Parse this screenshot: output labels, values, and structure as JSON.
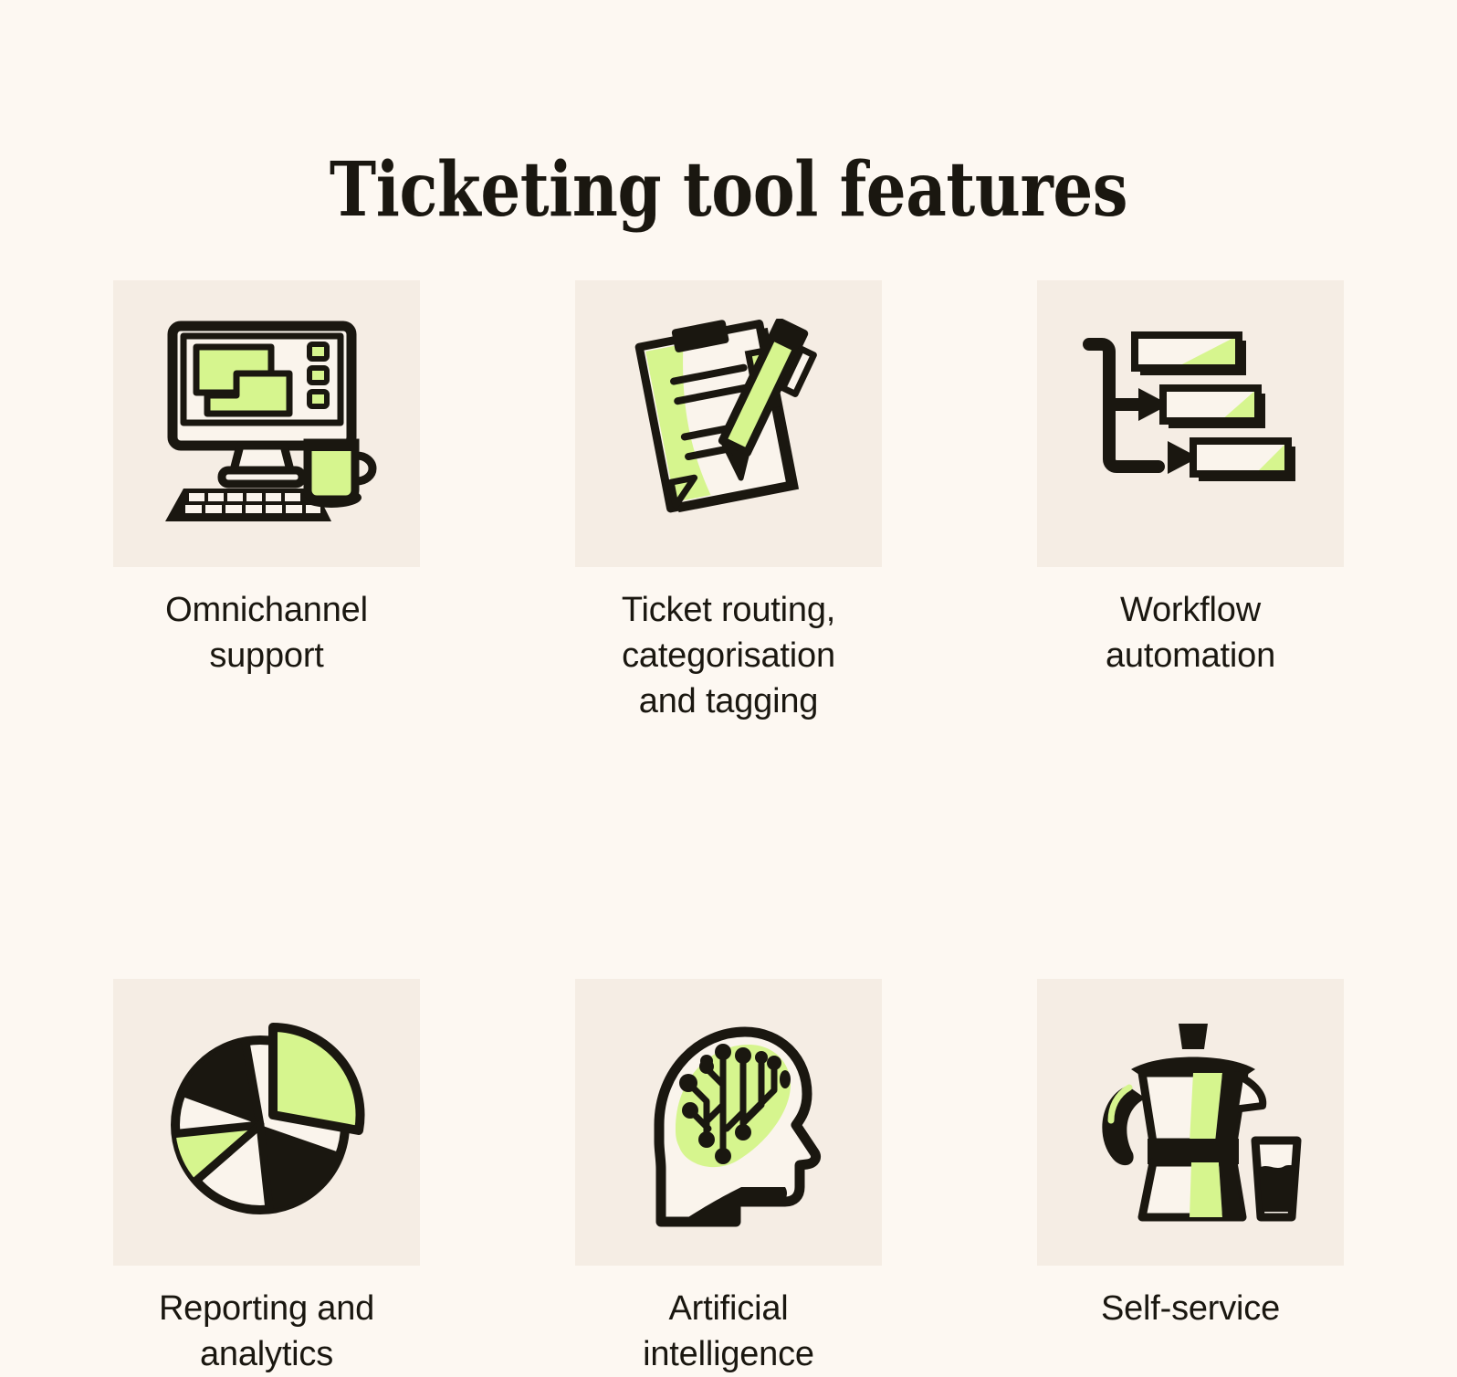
{
  "page": {
    "title": "Ticketing tool features",
    "background_color": "#FDF8F2",
    "tile_color": "#F5EDE4",
    "ink_color": "#1A1710",
    "accent_color": "#D6F58E"
  },
  "features": [
    {
      "id": "omnichannel-support",
      "caption": "Omnichannel\nsupport",
      "icon": "desktop-computer-icon"
    },
    {
      "id": "ticket-routing",
      "caption": "Ticket routing,\ncategorisation\nand tagging",
      "icon": "clipboard-pen-icon"
    },
    {
      "id": "workflow-automation",
      "caption": "Workflow\nautomation",
      "icon": "workflow-branch-icon"
    },
    {
      "id": "reporting-analytics",
      "caption": "Reporting and\nanalytics",
      "icon": "pie-chart-icon"
    },
    {
      "id": "artificial-intelligence",
      "caption": "Artificial\nintelligence",
      "icon": "brain-circuit-head-icon"
    },
    {
      "id": "self-service",
      "caption": "Self-service",
      "icon": "moka-pot-glass-icon"
    }
  ]
}
